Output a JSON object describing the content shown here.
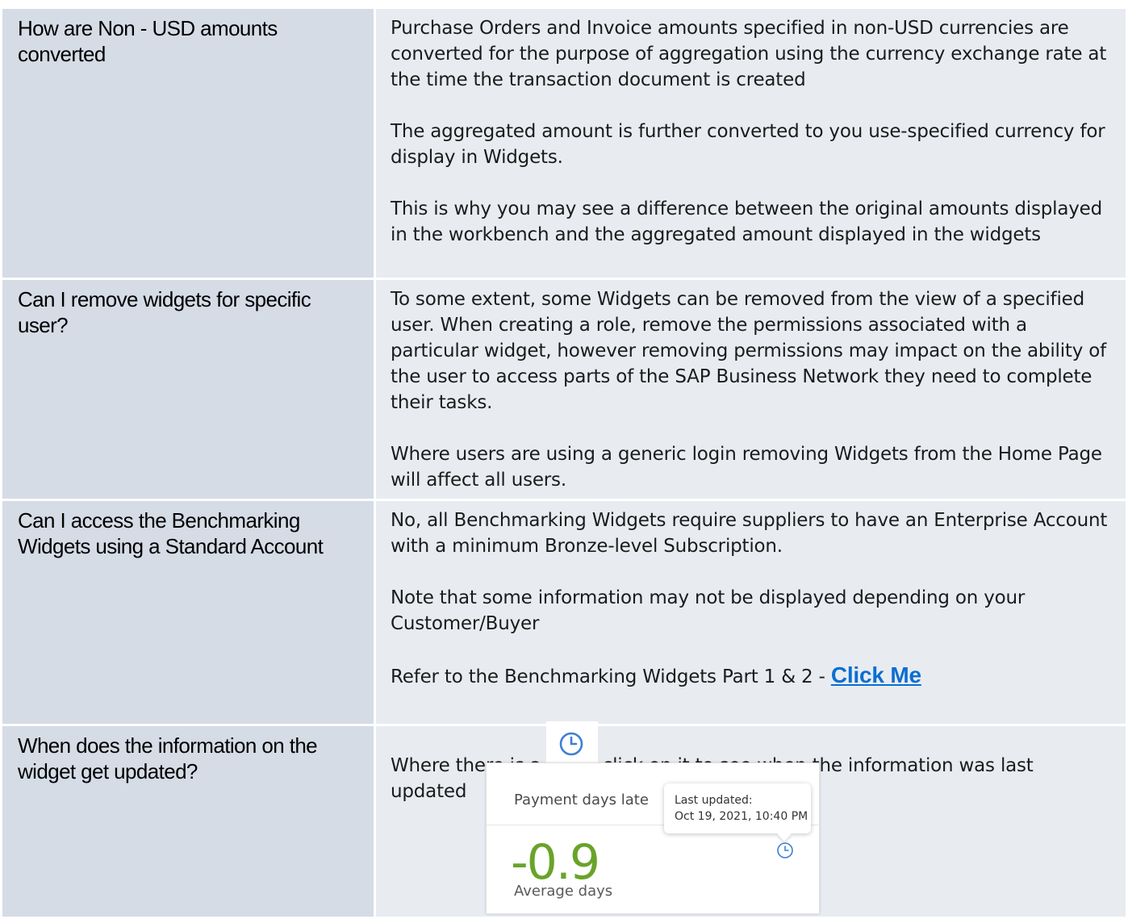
{
  "faq": [
    {
      "question": "How are Non - USD amounts converted",
      "answers": [
        "Purchase Orders and Invoice amounts specified in non-USD currencies are converted for the purpose of aggregation using the currency exchange rate at the time the transaction document is created",
        "The aggregated amount is further converted to you use-specified currency for display in Widgets.",
        "This is why you may see a difference between the original amounts displayed in the workbench and the aggregated amount displayed in the widgets"
      ]
    },
    {
      "question": "Can I remove widgets for specific user?",
      "answers": [
        "To some extent, some Widgets can be removed from the view of a specified user.   When creating a role, remove the permissions associated with a particular widget, however removing permissions may impact on the ability of the user to access parts of the SAP Business Network they need to complete their tasks.",
        "Where users are using a generic login removing Widgets from the Home Page will affect all users."
      ]
    },
    {
      "question": "Can I access the Benchmarking Widgets using a Standard Account",
      "answers": [
        "No, all Benchmarking Widgets require suppliers to have an Enterprise Account with a minimum Bronze-level Subscription.",
        "Note that some information may not be displayed depending on your Customer/Buyer"
      ],
      "refer_prefix": "Refer to the Benchmarking Widgets Part 1 & 2 - ",
      "link_label": "Click Me"
    },
    {
      "question": "When does the information on the widget get updated?",
      "answer_before_icon": "Where there is a",
      "answer_after_icon": "click on it to see when the information was last updated",
      "icon": "clock-icon"
    }
  ],
  "widget_example": {
    "title": "Payment days late",
    "value": "-0.9",
    "subtitle": "Average days",
    "tooltip_label": "Last updated:",
    "tooltip_value": "Oct 19, 2021, 10:40 PM",
    "value_color": "#6aa329",
    "icon_color": "#3d7fd6"
  }
}
